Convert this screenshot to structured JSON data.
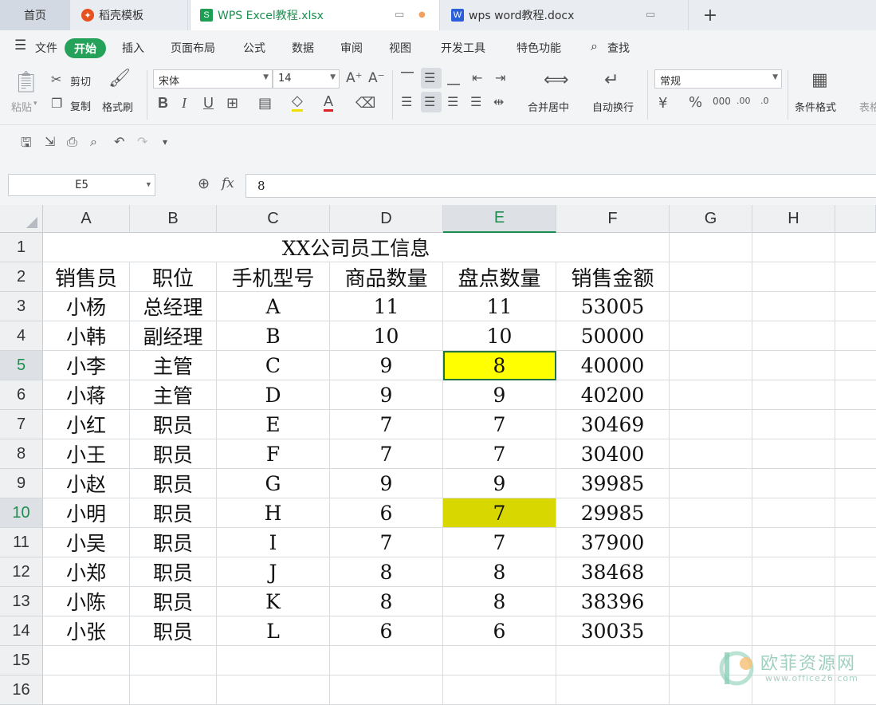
{
  "tabs": {
    "home": "首页",
    "template": "稻壳模板",
    "excel": "WPS Excel教程.xlsx",
    "word": "wps word教程.docx"
  },
  "menu": {
    "file": "文件",
    "start": "开始",
    "items": [
      "插入",
      "页面布局",
      "公式",
      "数据",
      "审阅",
      "视图",
      "开发工具",
      "特色功能"
    ],
    "search": "查找"
  },
  "ribbon": {
    "paste": "粘贴",
    "cut": "剪切",
    "copy": "复制",
    "format_painter": "格式刷",
    "font_name": "宋体",
    "font_size": "14",
    "merge_center": "合并居中",
    "wrap_text": "自动换行",
    "number_format": "常规",
    "conditional_format": "条件格式",
    "table_style": "表格"
  },
  "formula_bar": {
    "name_box": "E5",
    "fx": "fx",
    "value": "8"
  },
  "grid": {
    "columns": [
      "A",
      "B",
      "C",
      "D",
      "E",
      "F",
      "G",
      "H"
    ],
    "selected_column": "E",
    "row_numbers": [
      "1",
      "2",
      "3",
      "4",
      "5",
      "6",
      "7",
      "8",
      "9",
      "10",
      "11",
      "12",
      "13",
      "14",
      "15",
      "16"
    ],
    "selected_rows": [
      "5",
      "10"
    ],
    "title": "XX公司员工信息",
    "headers": [
      "销售员",
      "职位",
      "手机型号",
      "商品数量",
      "盘点数量",
      "销售金额"
    ],
    "rows": [
      [
        "小杨",
        "总经理",
        "A",
        "11",
        "11",
        "53005"
      ],
      [
        "小韩",
        "副经理",
        "B",
        "10",
        "10",
        "50000"
      ],
      [
        "小李",
        "主管",
        "C",
        "9",
        "8",
        "40000"
      ],
      [
        "小蒋",
        "主管",
        "D",
        "9",
        "9",
        "40200"
      ],
      [
        "小红",
        "职员",
        "E",
        "7",
        "7",
        "30469"
      ],
      [
        "小王",
        "职员",
        "F",
        "7",
        "7",
        "30400"
      ],
      [
        "小赵",
        "职员",
        "G",
        "9",
        "9",
        "39985"
      ],
      [
        "小明",
        "职员",
        "H",
        "6",
        "7",
        "29985"
      ],
      [
        "小吴",
        "职员",
        "I",
        "7",
        "7",
        "37900"
      ],
      [
        "小郑",
        "职员",
        "J",
        "8",
        "8",
        "38468"
      ],
      [
        "小陈",
        "职员",
        "K",
        "8",
        "8",
        "38396"
      ],
      [
        "小张",
        "职员",
        "L",
        "6",
        "6",
        "30035"
      ]
    ],
    "highlight_color_yellow": "#ffff00",
    "highlight_color_olive": "#d8d800"
  },
  "watermark": {
    "brand": "欧菲资源网",
    "url": "www.office26.com"
  },
  "colors": {
    "accent": "#24a25a",
    "excel_green": "#1c8e4f",
    "word_blue": "#2b5fd9",
    "template_red": "#e8501e"
  }
}
